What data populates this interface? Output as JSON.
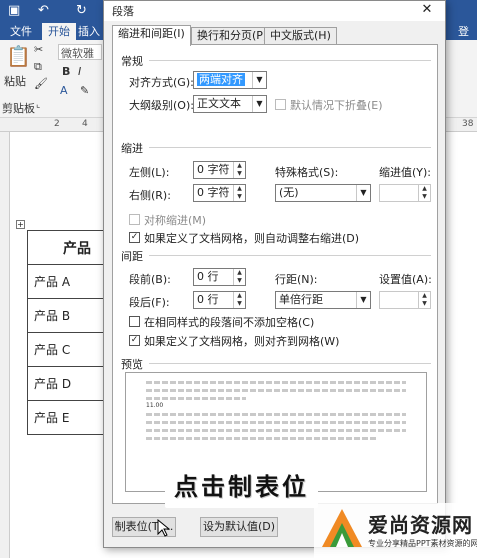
{
  "word": {
    "tabs": [
      "文件",
      "开始",
      "插入"
    ],
    "right_tab": "登录",
    "clipboard": {
      "paste_label": "粘贴",
      "group_label": "剪贴板"
    },
    "font_box_text": "微软雅黑",
    "ruler_numbers": [
      "2",
      "4",
      "38"
    ],
    "table_header": "产品",
    "table_rows": [
      "产品 A",
      "产品 B",
      "产品 C",
      "产品 D",
      "产品 E"
    ]
  },
  "dialog": {
    "title": "段落",
    "tabs": [
      "缩进和间距(I)",
      "换行和分页(P)",
      "中文版式(H)"
    ],
    "general": {
      "section": "常规",
      "alignment_label": "对齐方式(G):",
      "alignment_value": "两端对齐",
      "outline_label": "大纲级别(O):",
      "outline_value": "正文文本",
      "collapse_label": "默认情况下折叠(E)"
    },
    "indent": {
      "section": "缩进",
      "left_label": "左侧(L):",
      "left_value": "0 字符",
      "right_label": "右侧(R):",
      "right_value": "0 字符",
      "special_label": "特殊格式(S):",
      "special_value": "(无)",
      "by_label": "缩进值(Y):",
      "mirror_label": "对称缩进(M)",
      "auto_adjust_label": "如果定义了文档网格，则自动调整右缩进(D)"
    },
    "spacing": {
      "section": "间距",
      "before_label": "段前(B):",
      "before_value": "0 行",
      "after_label": "段后(F):",
      "after_value": "0 行",
      "line_label": "行距(N):",
      "line_value": "单倍行距",
      "at_label": "设置值(A):",
      "no_space_label": "在相同样式的段落间不添加空格(C)",
      "snap_grid_label": "如果定义了文档网格，则对齐到网格(W)"
    },
    "preview": {
      "section": "预览",
      "sample_text": "11.00"
    },
    "buttons": {
      "tabs": "制表位(T)...",
      "default": "设为默认值(D)"
    }
  },
  "overlay": {
    "caption": "点击制表位",
    "watermark_title": "爱尚资源网",
    "watermark_sub": "专业分享精品PPT素材资源的网站"
  },
  "colors": {
    "word_blue": "#2b579a",
    "selection": "#3399ff",
    "logo_orange": "#f08a24",
    "logo_green": "#3a9a3a"
  }
}
